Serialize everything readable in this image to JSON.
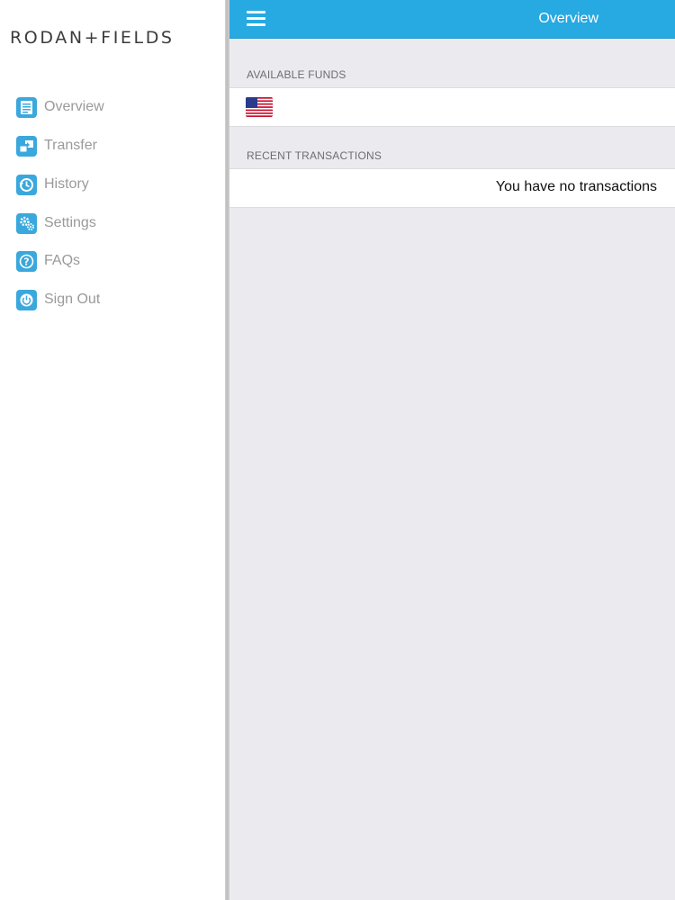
{
  "brand": {
    "logo_text": "RODAN+FIELDS"
  },
  "sidebar": {
    "items": [
      {
        "label": "Overview",
        "icon": "document-icon"
      },
      {
        "label": "Transfer",
        "icon": "transfer-icon"
      },
      {
        "label": "History",
        "icon": "history-icon"
      },
      {
        "label": "Settings",
        "icon": "gear-icon"
      },
      {
        "label": "FAQs",
        "icon": "question-icon"
      },
      {
        "label": "Sign Out",
        "icon": "power-icon"
      }
    ]
  },
  "header": {
    "title": "Overview",
    "menu_icon": "hamburger-menu-icon"
  },
  "funds": {
    "section_label": "AVAILABLE FUNDS",
    "currency_flag": "us-flag-icon"
  },
  "transactions": {
    "section_label": "RECENT TRANSACTIONS",
    "empty_message": "You have no transactions"
  },
  "colors": {
    "accent": "#27a9e1",
    "icon_bg": "#3aa8dc",
    "background": "#ebebef"
  }
}
